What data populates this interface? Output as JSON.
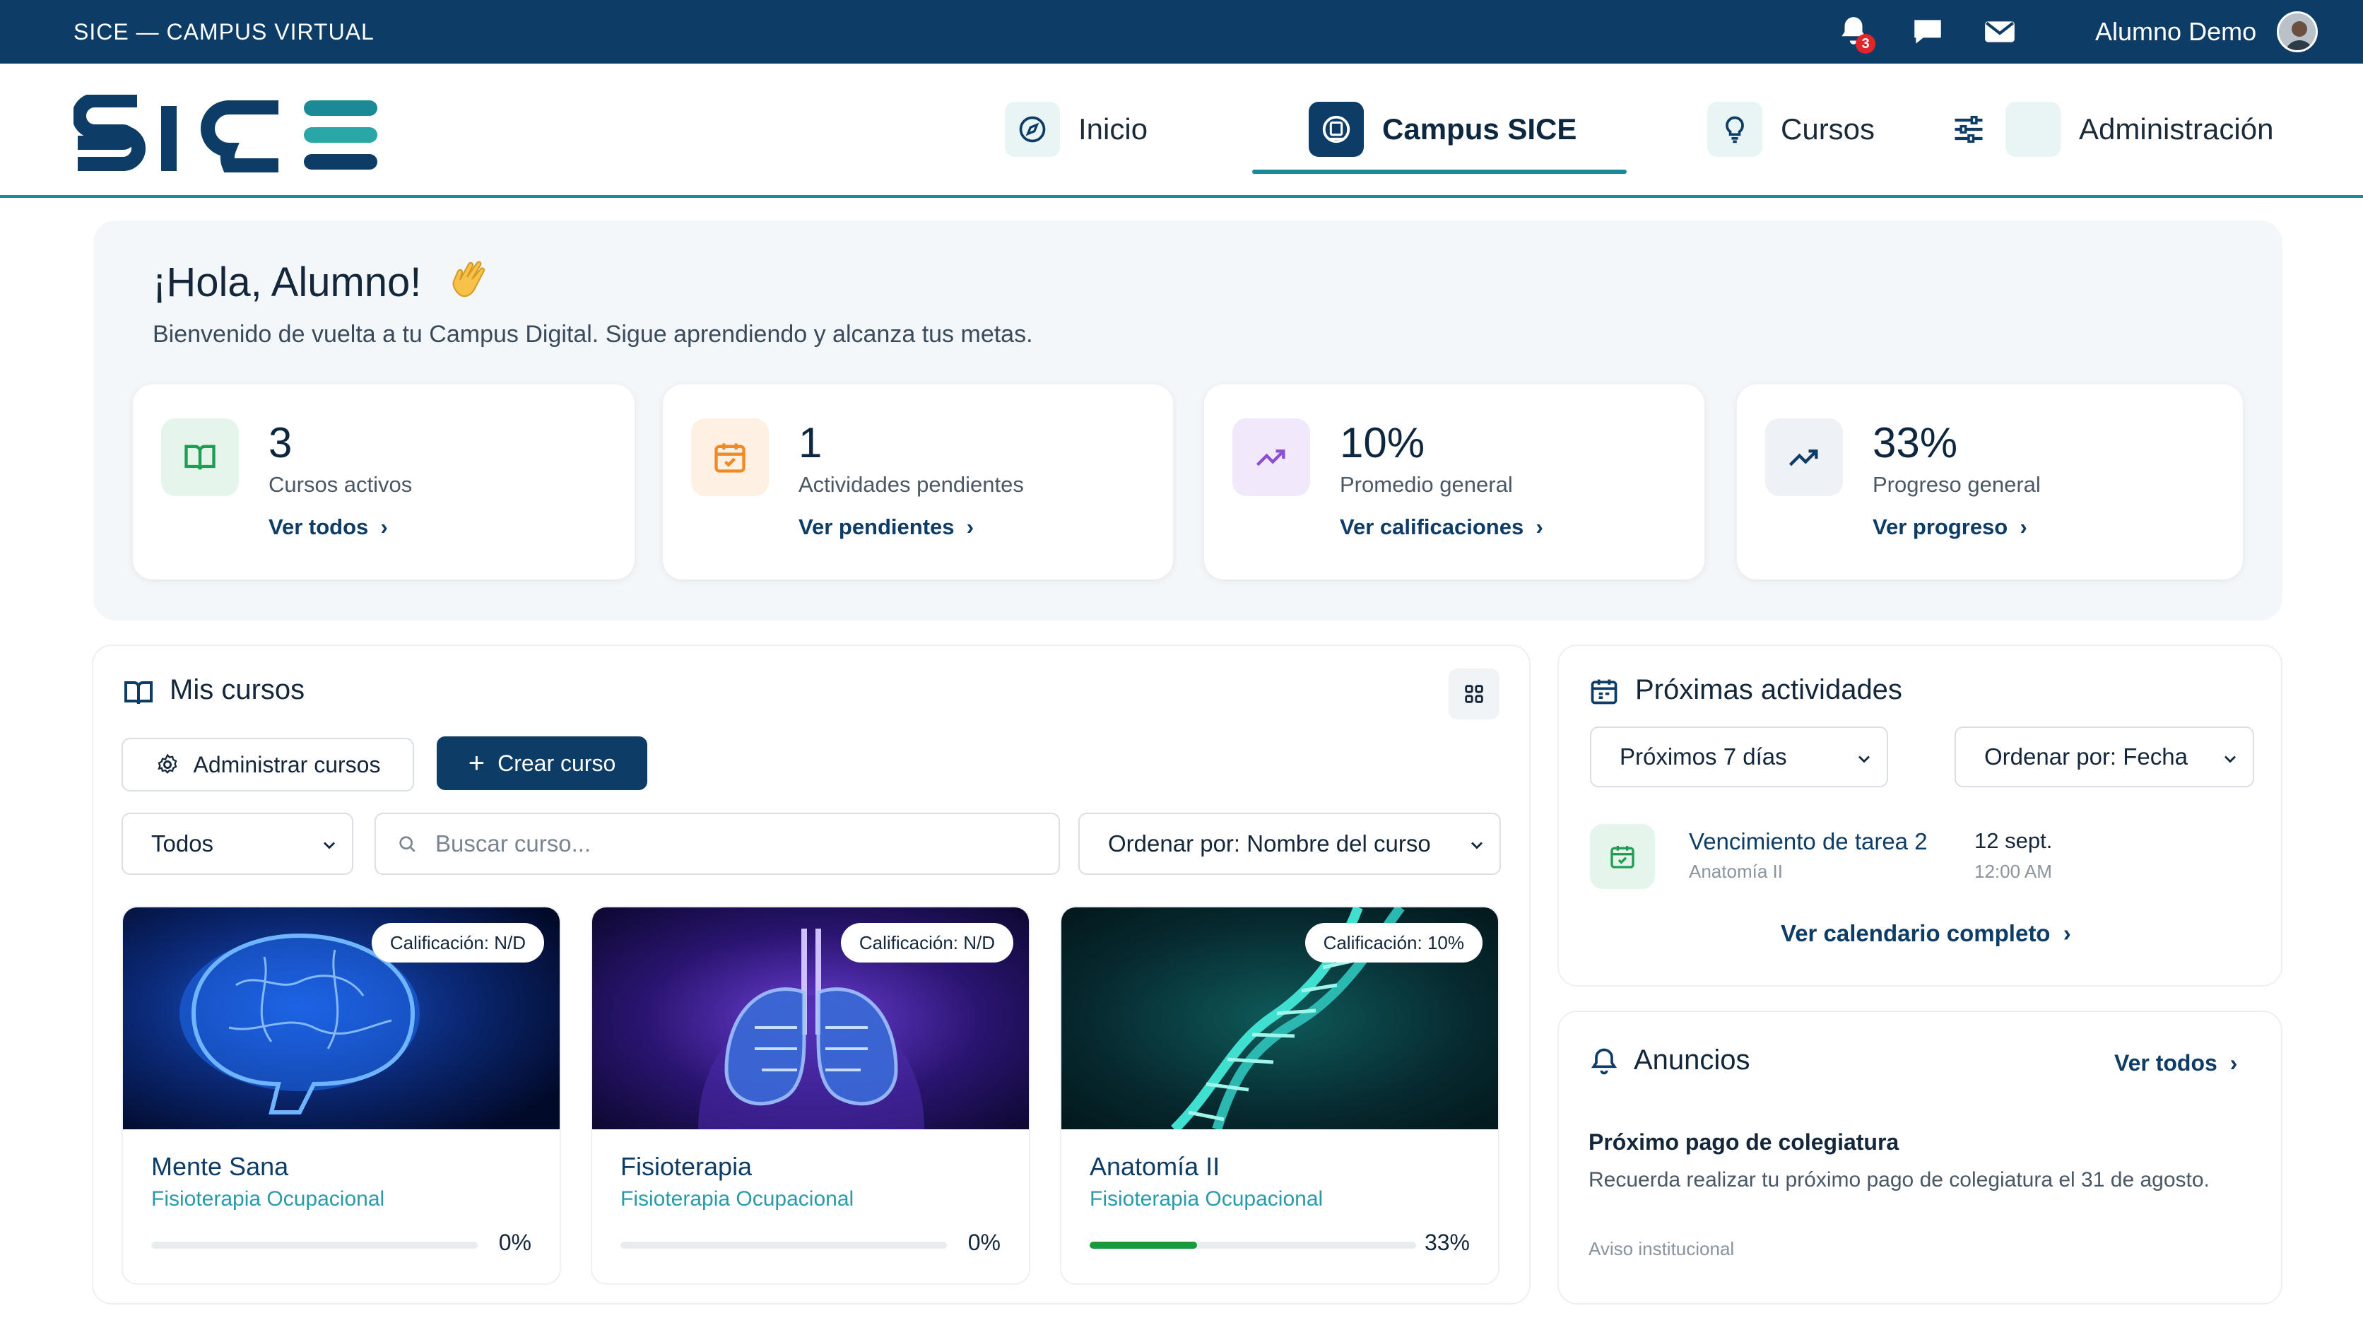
{
  "topbar": {
    "title": "SICE — CAMPUS VIRTUAL",
    "notifications_count": "3",
    "user_name": "Alumno Demo"
  },
  "nav": {
    "items": [
      {
        "label": "Inicio",
        "icon": "compass-icon"
      },
      {
        "label": "Campus SICE",
        "icon": "campus-icon",
        "active": true
      },
      {
        "label": "Cursos",
        "icon": "lightbulb-icon"
      },
      {
        "label": "Administración",
        "icon": "sliders-icon"
      }
    ]
  },
  "welcome": {
    "greeting": "¡Hola, Alumno!",
    "subtitle": "Bienvenido de vuelta a tu Campus Digital. Sigue aprendiendo y alcanza tus metas.",
    "stats": [
      {
        "value": "3",
        "label": "Cursos activos",
        "link": "Ver todos",
        "icon": "book-icon",
        "color": "#1f9d55"
      },
      {
        "value": "1",
        "label": "Actividades pendientes",
        "link": "Ver pendientes",
        "icon": "calendar-icon",
        "color": "#f08a24"
      },
      {
        "value": "10%",
        "label": "Promedio general",
        "link": "Ver calificaciones",
        "icon": "trend-up-icon",
        "color": "#8a4fd6"
      },
      {
        "value": "33%",
        "label": "Progreso general",
        "link": "Ver progreso",
        "icon": "trend-up-icon",
        "color": "#0d3c66"
      }
    ]
  },
  "courses_panel": {
    "title": "Mis cursos",
    "manage_button": "Administrar cursos",
    "create_button": "Crear curso",
    "filter_value": "Todos",
    "search_placeholder": "Buscar curso...",
    "sort_value": "Ordenar por: Nombre del curso",
    "courses": [
      {
        "name": "Mente Sana",
        "program": "Fisioterapia Ocupacional",
        "grade": "Calificación: N/D",
        "progress": 0,
        "progress_label": "0%",
        "image": "brain-image"
      },
      {
        "name": "Fisioterapia",
        "program": "Fisioterapia Ocupacional",
        "grade": "Calificación: N/D",
        "progress": 0,
        "progress_label": "0%",
        "image": "lungs-image"
      },
      {
        "name": "Anatomía II",
        "program": "Fisioterapia Ocupacional",
        "grade": "Calificación: 10%",
        "progress": 33,
        "progress_label": "33%",
        "image": "dna-image"
      }
    ]
  },
  "activities_panel": {
    "title": "Próximas actividades",
    "range_value": "Próximos 7 días",
    "sort_value": "Ordenar por: Fecha",
    "items": [
      {
        "title": "Vencimiento de tarea 2",
        "course": "Anatomía II",
        "date": "12 sept.",
        "time": "12:00 AM"
      }
    ],
    "calendar_link": "Ver calendario completo"
  },
  "announcements_panel": {
    "title": "Anuncios",
    "see_all": "Ver todos",
    "items": [
      {
        "title": "Próximo pago de colegiatura",
        "body": "Recuerda realizar tu próximo pago de colegiatura el 31 de agosto.",
        "source": "Aviso institucional"
      }
    ]
  }
}
